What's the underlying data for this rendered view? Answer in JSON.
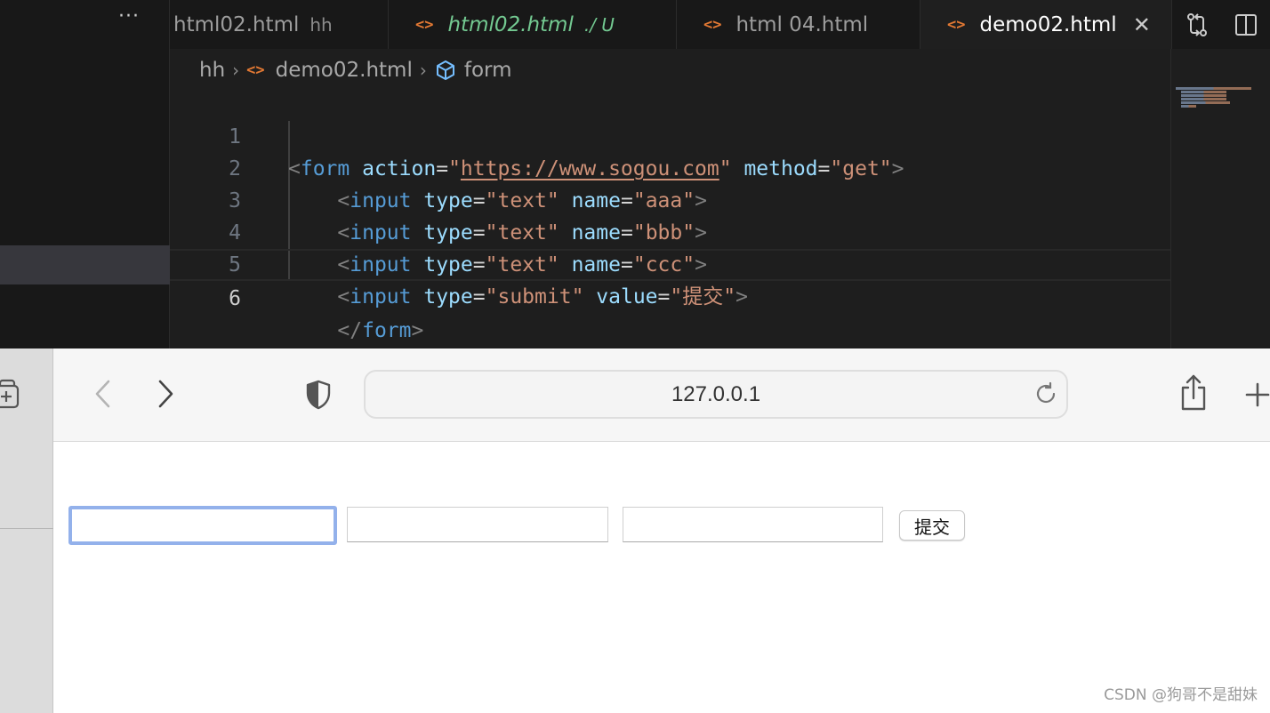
{
  "editor": {
    "more_label": "···",
    "tabs": [
      {
        "label": "html02.html",
        "description": "hh"
      },
      {
        "label": "html02.html",
        "description": "./ U"
      },
      {
        "label": "html 04.html",
        "description": ""
      },
      {
        "label": "demo02.html",
        "description": "",
        "close_glyph": "✕"
      }
    ],
    "tab_icon_glyph": "<>",
    "breadcrumb": {
      "folder": "hh",
      "file": "demo02.html",
      "symbol": "form",
      "separator": "›"
    },
    "line_numbers": [
      "1",
      "2",
      "3",
      "4",
      "5",
      "6"
    ],
    "code": {
      "l1": {
        "open": "<",
        "tag": "form",
        "a1": "action",
        "eq": "=",
        "q": "\"",
        "v1": "https://www.sogou.com",
        "a2": "method",
        "v2": "get",
        "close": ">"
      },
      "l2": {
        "open": "<",
        "tag": "input",
        "a1": "type",
        "eq": "=",
        "q": "\"",
        "v1": "text",
        "a2": "name",
        "v2": "aaa",
        "close": ">"
      },
      "l3": {
        "open": "<",
        "tag": "input",
        "a1": "type",
        "eq": "=",
        "q": "\"",
        "v1": "text",
        "a2": "name",
        "v2": "bbb",
        "close": ">"
      },
      "l4": {
        "open": "<",
        "tag": "input",
        "a1": "type",
        "eq": "=",
        "q": "\"",
        "v1": "text",
        "a2": "name",
        "v2": "ccc",
        "close": ">"
      },
      "l5": {
        "open": "<",
        "tag": "input",
        "a1": "type",
        "eq": "=",
        "q": "\"",
        "v1": "submit",
        "a2": "value",
        "v2": "提交",
        "close": ">"
      },
      "l6": {
        "open": "</",
        "tag": "form",
        "close": ">"
      }
    },
    "colors": {
      "tag": "#569cd6",
      "attr": "#9cdcfe",
      "string": "#ce9178",
      "punct": "#808080",
      "modified": "#73c991",
      "file_icon": "#e37933"
    }
  },
  "browser": {
    "address": "127.0.0.1",
    "icons": {
      "back": "chevron-left-icon",
      "forward": "chevron-right-icon",
      "shield": "privacy-shield-icon",
      "reload": "reload-icon",
      "share": "share-icon",
      "new_tab": "plus-icon",
      "tab_group": "tab-group-icon"
    },
    "form": {
      "inputs": [
        {
          "name": "aaa",
          "value": ""
        },
        {
          "name": "bbb",
          "value": ""
        },
        {
          "name": "ccc",
          "value": ""
        }
      ],
      "submit_label": "提交"
    },
    "focus_ring_color": "#93b1eb"
  },
  "watermark": "CSDN @狗哥不是甜妹"
}
